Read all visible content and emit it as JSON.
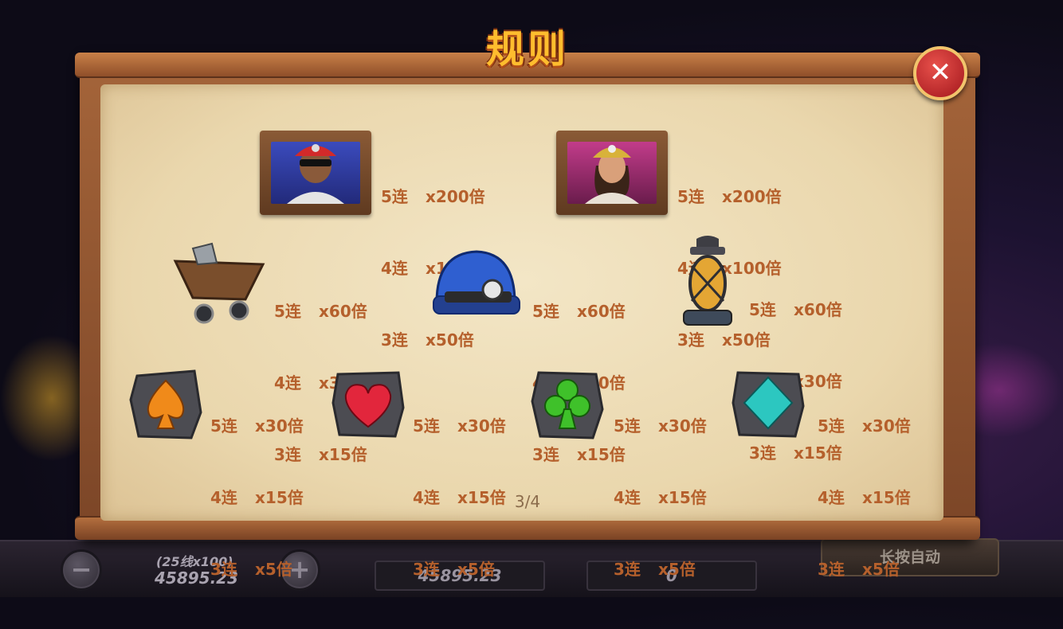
{
  "title": "规则",
  "close_label": "✕",
  "page_indicator": "3/4",
  "bottom_bar": {
    "minus": "−",
    "plus": "+",
    "bet_lines": "(25线x100)",
    "bet_value": "45895.23",
    "balance": "45895.23",
    "win": "0",
    "auto_label": "长按自动"
  },
  "symbols": {
    "miner_male": {
      "icon": "male-miner-icon",
      "rows": [
        [
          "5连",
          "x200倍"
        ],
        [
          "4连",
          "x100倍"
        ],
        [
          "3连",
          "x50倍"
        ]
      ]
    },
    "miner_female": {
      "icon": "female-miner-icon",
      "rows": [
        [
          "5连",
          "x200倍"
        ],
        [
          "4连",
          "x100倍"
        ],
        [
          "3连",
          "x50倍"
        ]
      ]
    },
    "mine_cart": {
      "icon": "mine-cart-icon",
      "rows": [
        [
          "5连",
          "x60倍"
        ],
        [
          "4连",
          "x30倍"
        ],
        [
          "3连",
          "x15倍"
        ]
      ]
    },
    "helmet": {
      "icon": "helmet-icon",
      "rows": [
        [
          "5连",
          "x60倍"
        ],
        [
          "4连",
          "x30倍"
        ],
        [
          "3连",
          "x15倍"
        ]
      ]
    },
    "lantern": {
      "icon": "lantern-icon",
      "rows": [
        [
          "5连",
          "x60倍"
        ],
        [
          "4连",
          "x30倍"
        ],
        [
          "3连",
          "x15倍"
        ]
      ]
    },
    "spade": {
      "icon": "spade-icon",
      "color": "#f08a1a",
      "rows": [
        [
          "5连",
          "x30倍"
        ],
        [
          "4连",
          "x15倍"
        ],
        [
          "3连",
          "x5倍"
        ]
      ]
    },
    "heart": {
      "icon": "heart-icon",
      "color": "#e2263c",
      "rows": [
        [
          "5连",
          "x30倍"
        ],
        [
          "4连",
          "x15倍"
        ],
        [
          "3连",
          "x5倍"
        ]
      ]
    },
    "club": {
      "icon": "club-icon",
      "color": "#3fc12a",
      "rows": [
        [
          "5连",
          "x30倍"
        ],
        [
          "4连",
          "x15倍"
        ],
        [
          "3连",
          "x5倍"
        ]
      ]
    },
    "diamond": {
      "icon": "diamond-icon",
      "color": "#2cc7c0",
      "rows": [
        [
          "5连",
          "x30倍"
        ],
        [
          "4连",
          "x15倍"
        ],
        [
          "3连",
          "x5倍"
        ]
      ]
    }
  }
}
